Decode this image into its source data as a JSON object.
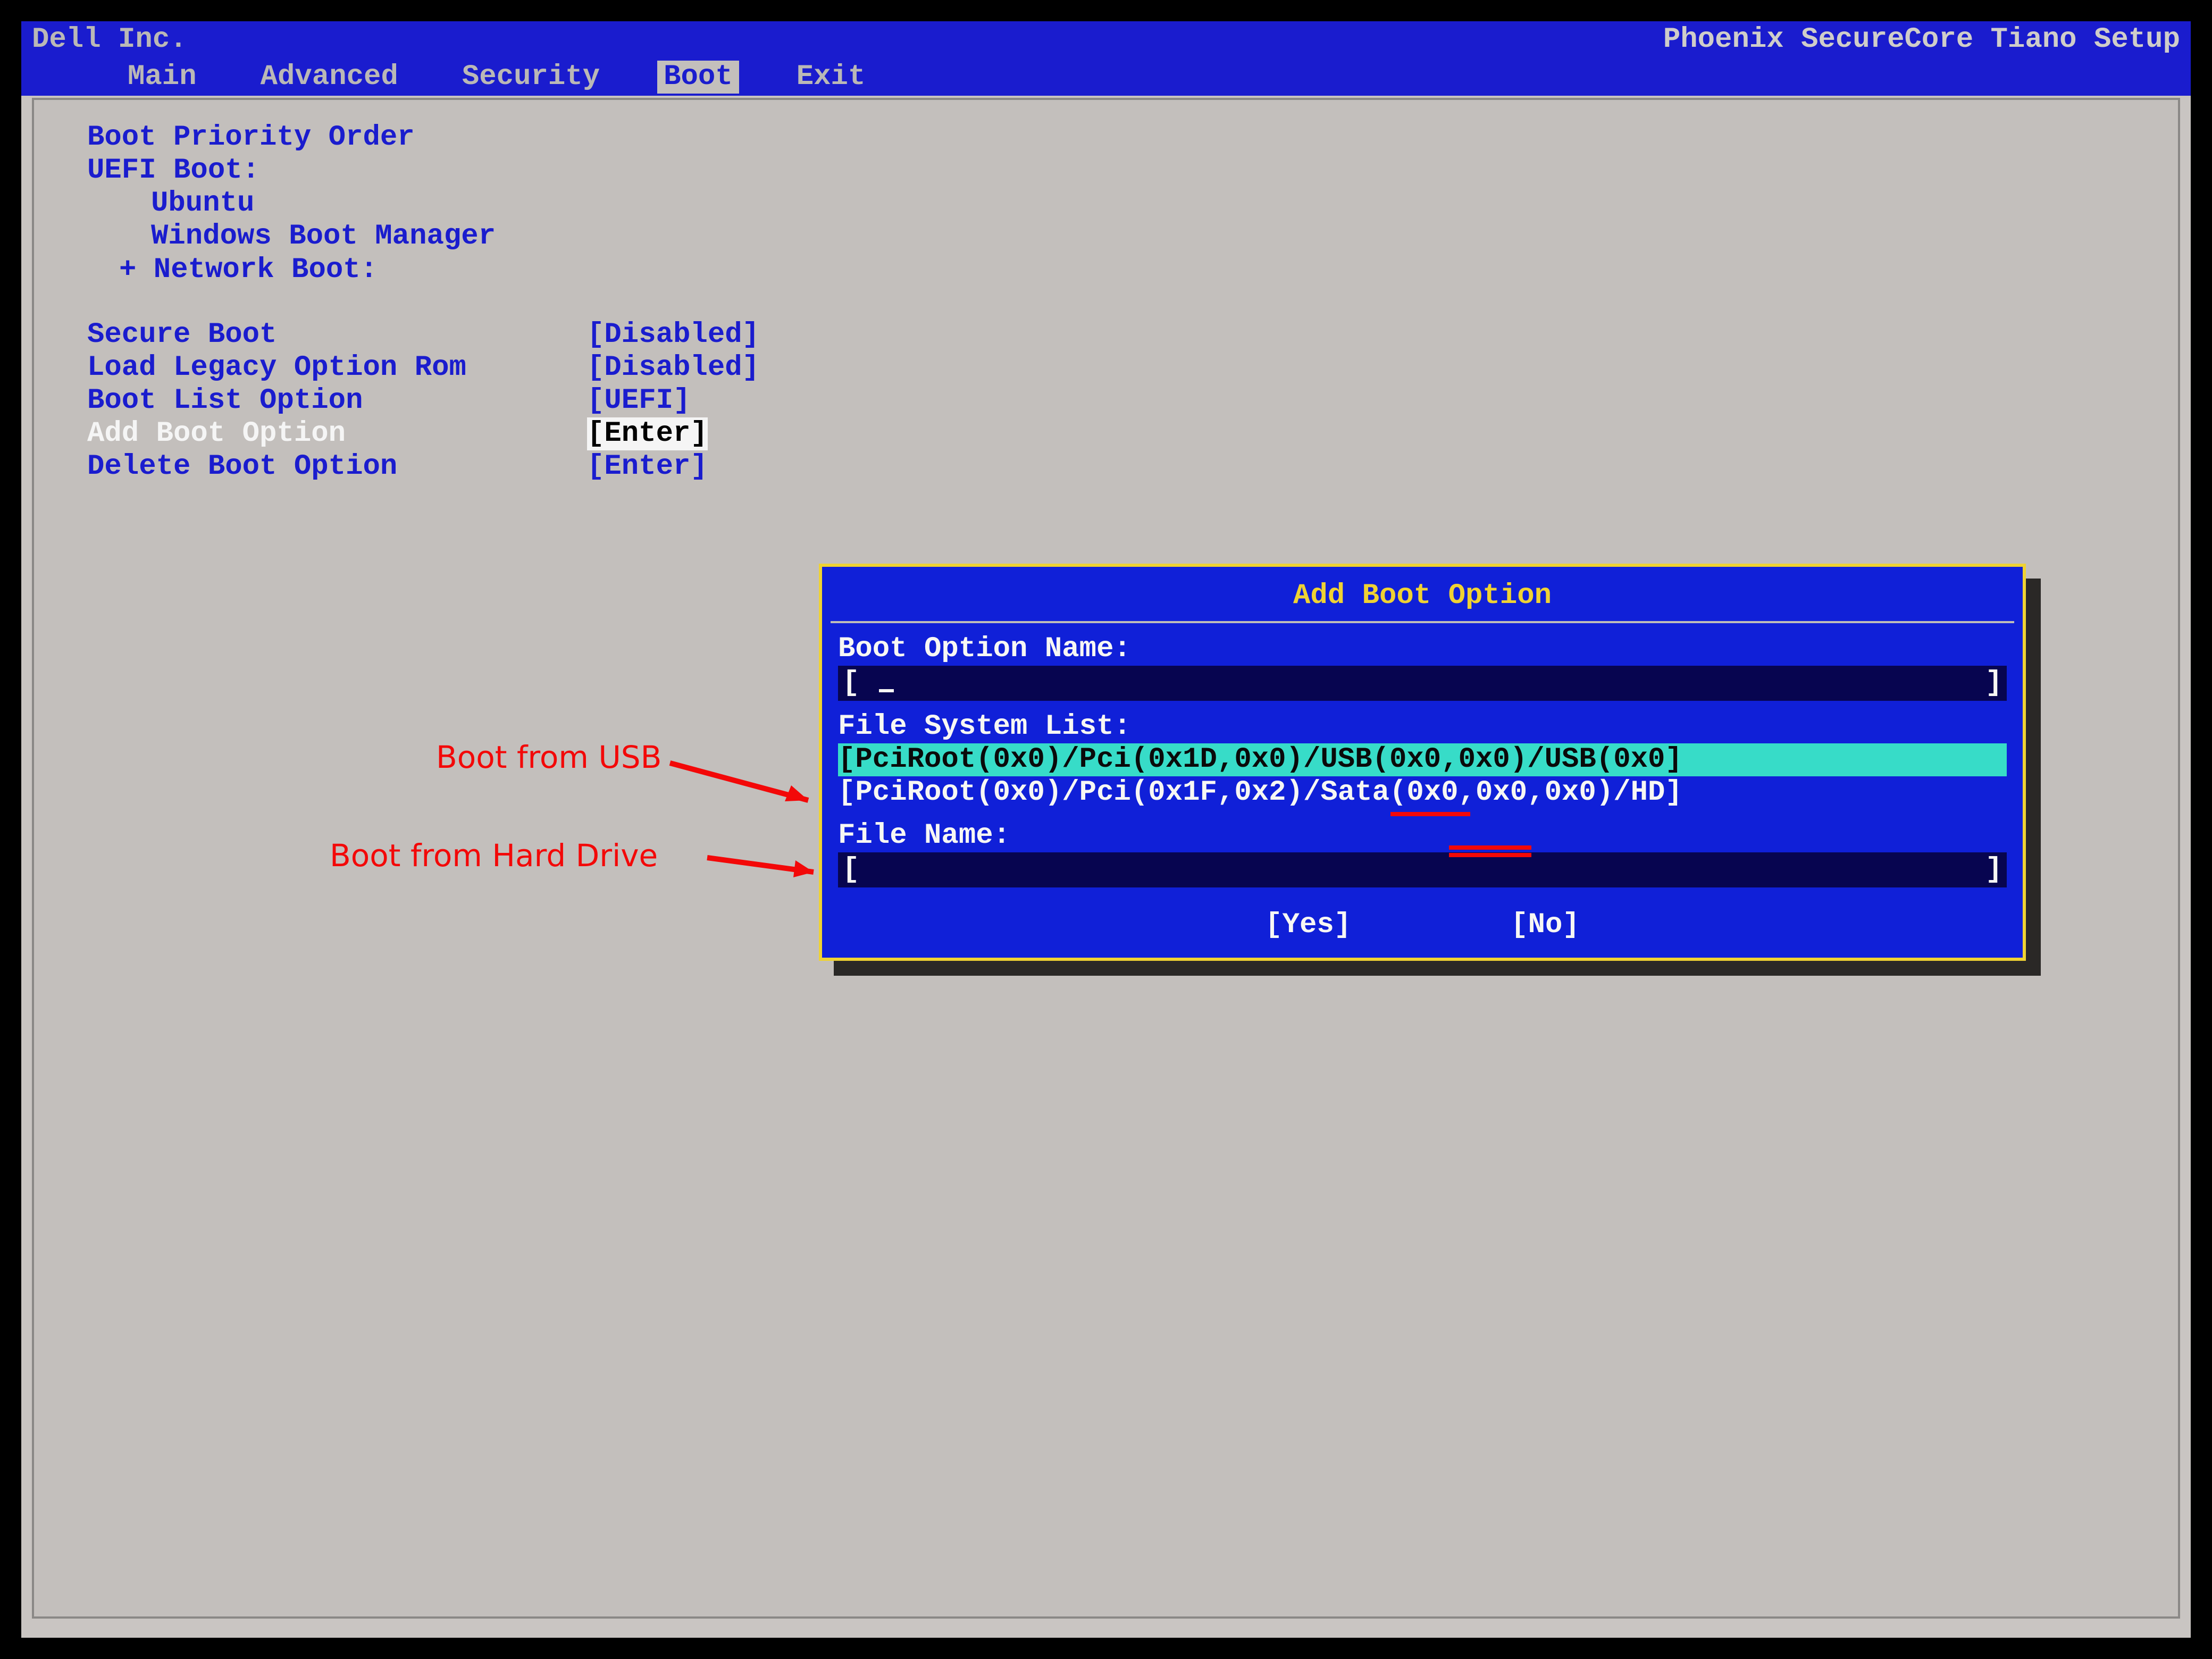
{
  "titlebar": {
    "left": "Dell Inc.",
    "right": "Phoenix SecureCore Tiano Setup"
  },
  "menu": [
    {
      "label": "Main",
      "active": false
    },
    {
      "label": "Advanced",
      "active": false
    },
    {
      "label": "Security",
      "active": false
    },
    {
      "label": "Boot",
      "active": true
    },
    {
      "label": "Exit",
      "active": false
    }
  ],
  "boot": {
    "heading": "Boot Priority Order",
    "uefi_heading": "UEFI Boot:",
    "uefi_items": [
      "Ubuntu",
      "Windows Boot Manager"
    ],
    "network_heading": "+ Network Boot:",
    "options": [
      {
        "label": "Secure Boot",
        "value": "[Disabled]",
        "selected": false
      },
      {
        "label": "Load Legacy Option Rom",
        "value": "[Disabled]",
        "selected": false
      },
      {
        "label": "Boot List Option",
        "value": "[UEFI]",
        "selected": false
      },
      {
        "label": "Add Boot Option",
        "value": "[Enter]",
        "selected": true
      },
      {
        "label": "Delete Boot Option",
        "value": "[Enter]",
        "selected": false
      }
    ]
  },
  "dialog": {
    "title": "Add Boot Option",
    "name_label": "Boot Option Name:",
    "name_value": "",
    "fslist_label": "File System List:",
    "fslist": [
      {
        "text": "[PciRoot(0x0)/Pci(0x1D,0x0)/USB(0x0,0x0)/USB(0x0]",
        "selected": true
      },
      {
        "text": "[PciRoot(0x0)/Pci(0x1F,0x2)/Sata(0x0,0x0,0x0)/HD]",
        "selected": false
      }
    ],
    "filename_label": "File Name:",
    "filename_value": "",
    "yes": "[Yes]",
    "no": "[No]"
  },
  "annotations": {
    "usb": "Boot from USB",
    "hdd": "Boot from Hard Drive"
  }
}
